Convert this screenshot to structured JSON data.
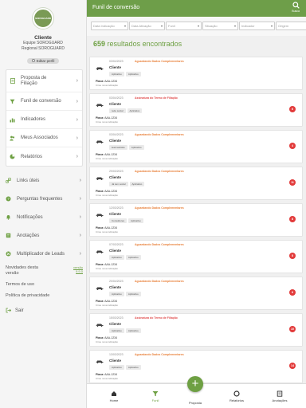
{
  "profile": {
    "logo_text": "SOROGUARD",
    "name": "Cliente",
    "team": "Equipe SOROGUARD",
    "region": "Regional SOROGUARD",
    "edit_label": "Editar perfil"
  },
  "menu": [
    {
      "label": "Proposta de Filiação",
      "icon": "document-icon"
    },
    {
      "label": "Funil de conversão",
      "icon": "funnel-icon"
    },
    {
      "label": "Indicadores",
      "icon": "chart-icon"
    },
    {
      "label": "Meus Associados",
      "icon": "users-icon"
    },
    {
      "label": "Relatórios",
      "icon": "pie-chart-icon"
    }
  ],
  "lower_menu": [
    {
      "label": "Links úteis",
      "icon": "link-icon"
    },
    {
      "label": "Perguntas frequentes",
      "icon": "help-icon"
    },
    {
      "label": "Notificações",
      "icon": "bell-icon"
    },
    {
      "label": "Anotações",
      "icon": "notes-icon"
    },
    {
      "label": "Multiplicador de Leads",
      "icon": "multiply-icon"
    }
  ],
  "footer_links": {
    "news": "Novidades desta versão",
    "version": "versão 9.9.0",
    "terms": "Termos de uso",
    "privacy": "Política de privacidade",
    "logout": "Sair"
  },
  "header": {
    "title": "Funil de conversão",
    "search_label": "Busca"
  },
  "filters": [
    {
      "placeholder": "Data Indicação"
    },
    {
      "placeholder": "Data Ativação"
    },
    {
      "placeholder": "Funil"
    },
    {
      "placeholder": "Situação"
    },
    {
      "placeholder": "Indicador"
    },
    {
      "placeholder": "Origem"
    }
  ],
  "results": {
    "count": "659",
    "label": "resultados encontrados"
  },
  "cards": [
    {
      "date": "03/04/2023",
      "status": "Aguardando Dados Complementares",
      "status_color": "orange",
      "client": "Cliente",
      "tags": [
        "Aplicativo",
        "Aplicativo"
      ],
      "plate_label": "Placa:",
      "plate": "AAA-1234",
      "origin": "Criou nova indicação",
      "badge": ""
    },
    {
      "date": "03/04/2023",
      "status": "Assinatura do Termo de Filiação",
      "status_color": "red",
      "client": "Cliente",
      "tags": [
        "rede social",
        "Aplicativo"
      ],
      "plate_label": "Placa:",
      "plate": "AAA-1234",
      "origin": "Criou nova indicação",
      "badge": "6"
    },
    {
      "date": "03/04/2023",
      "status": "Aguardando Dados Complementares",
      "status_color": "orange",
      "client": "Cliente",
      "tags": [
        "lead website",
        "Aplicativo"
      ],
      "plate_label": "Placa:",
      "plate": "AAA-1234",
      "origin": "Criou nova indicação",
      "badge": "4"
    },
    {
      "date": "29/03/2023",
      "status": "Aguardando Dados Complementares",
      "status_color": "orange",
      "client": "Cliente",
      "tags": [
        "Já tem social",
        "Aplicativo"
      ],
      "plate_label": "Placa:",
      "plate": "AAA-1234",
      "origin": "Criou nova indicação",
      "badge": "11"
    },
    {
      "date": "12/03/2023",
      "status": "Aguardando Dados Complementares",
      "status_color": "orange",
      "client": "Cliente",
      "tags": [
        "Consultores",
        "Aplicativo"
      ],
      "plate_label": "Placa:",
      "plate": "AAA-1234",
      "origin": "Criou nova indicação",
      "badge": "8"
    },
    {
      "date": "07/03/2023",
      "status": "Aguardando Dados Complementares",
      "status_color": "orange",
      "client": "Cliente",
      "tags": [
        "Aplicativo",
        "Aplicativo"
      ],
      "plate_label": "Placa:",
      "plate": "AAA-1234",
      "origin": "Criou nova indicação",
      "badge": "8"
    },
    {
      "date": "20/04/2023",
      "status": "Aguardando Dados Complementares",
      "status_color": "orange",
      "client": "Cliente",
      "tags": [
        "Aplicativo",
        "Aplicativo"
      ],
      "plate_label": "Placa:",
      "plate": "AAA-1234",
      "origin": "Criou nova indicação",
      "badge": "6"
    },
    {
      "date": "15/03/2023",
      "status": "Assinatura do Termo de Filiação",
      "status_color": "red",
      "client": "Cliente",
      "tags": [
        "Aplicativo",
        "Aplicativo"
      ],
      "plate_label": "Placa:",
      "plate": "AAA-1234",
      "origin": "Criou nova indicação",
      "badge": "10"
    },
    {
      "date": "13/03/2023",
      "status": "Aguardando Dados Complementares",
      "status_color": "orange",
      "client": "Cliente",
      "tags": [
        "Aplicativo",
        "Aplicativo"
      ],
      "plate_label": "Placa:",
      "plate": "AAA-1234",
      "origin": "Criou nova indicação",
      "badge": "14"
    }
  ],
  "tabbar": {
    "home": "Home",
    "funil": "Funil",
    "proposta": "Proposta",
    "relatorios": "Relatórios",
    "anotacoes": "Anotações",
    "fab_symbol": "+"
  },
  "colors": {
    "brand_green": "#6e9e49",
    "status_orange": "#e8803a",
    "status_red": "#e04a4a",
    "badge_red": "#e23b3b"
  }
}
